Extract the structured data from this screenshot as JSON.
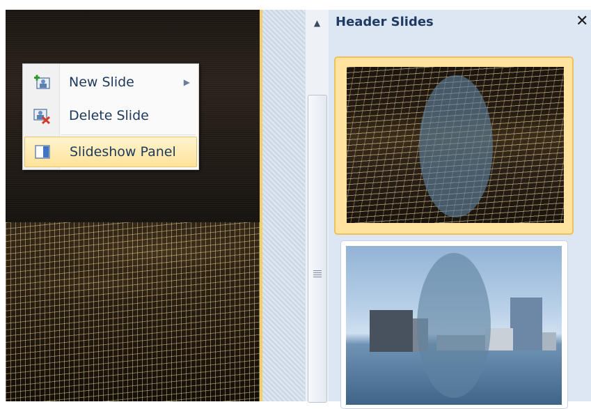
{
  "context_menu": {
    "items": [
      {
        "label": "New Slide",
        "icon": "new-slide-icon",
        "has_submenu": true
      },
      {
        "label": "Delete Slide",
        "icon": "delete-slide-icon",
        "has_submenu": false
      },
      {
        "label": "Slideshow Panel",
        "icon": "slideshow-panel-icon",
        "has_submenu": false,
        "highlighted": true
      }
    ],
    "submenu_arrow": "▶"
  },
  "scrollbar": {
    "up_arrow": "▲"
  },
  "pane": {
    "title": "Header Slides",
    "close_glyph": "✕",
    "thumbnails": [
      {
        "name": "night-city-slide",
        "selected": true
      },
      {
        "name": "waterfront-city-slide",
        "selected": false
      }
    ]
  },
  "colors": {
    "accent_highlight": "#fde39a",
    "selection_border": "#f0c05a",
    "pane_background": "#dde7f3",
    "menu_text": "#1e395b"
  }
}
